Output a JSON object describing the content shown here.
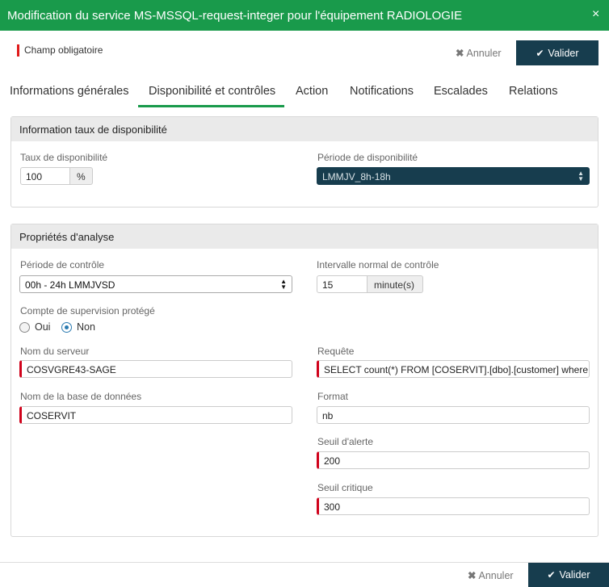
{
  "dialog": {
    "title": "Modification du service MS-MSSQL-request-integer pour l'équipement RADIOLOGIE",
    "close_icon": "×",
    "required_note": "Champ obligatoire"
  },
  "actions": {
    "cancel_label": "Annuler",
    "validate_label": "Valider"
  },
  "tabs": [
    {
      "label": "Informations générales"
    },
    {
      "label": "Disponibilité et contrôles",
      "active": true
    },
    {
      "label": "Action"
    },
    {
      "label": "Notifications"
    },
    {
      "label": "Escalades"
    },
    {
      "label": "Relations"
    }
  ],
  "availability": {
    "header": "Information taux de disponibilité",
    "rate_label": "Taux de disponibilité",
    "rate_value": "100",
    "rate_unit": "%",
    "period_label": "Période de disponibilité",
    "period_value": "LMMJV_8h-18h"
  },
  "analysis": {
    "header": "Propriétés d'analyse",
    "check_period_label": "Période de contrôle",
    "check_period_value": "00h - 24h LMMJVSD",
    "interval_label": "Intervalle normal de contrôle",
    "interval_value": "15",
    "interval_unit": "minute(s)",
    "protected_label": "Compte de supervision protégé",
    "protected_options": [
      "Oui",
      "Non"
    ],
    "protected_selected": "Non",
    "server_label": "Nom du serveur",
    "server_value": "COSVGRE43-SAGE",
    "database_label": "Nom de la base de données",
    "database_value": "COSERVIT",
    "query_label": "Requête",
    "query_value": "SELECT count(*) FROM [COSERVIT].[dbo].[customer] where",
    "format_label": "Format",
    "format_value": "nb",
    "warning_label": "Seuil d'alerte",
    "warning_value": "200",
    "critical_label": "Seuil critique",
    "critical_value": "300"
  },
  "colors": {
    "header_green": "#199a4b",
    "primary_dark": "#173d4e",
    "required_red": "#d0021b"
  }
}
